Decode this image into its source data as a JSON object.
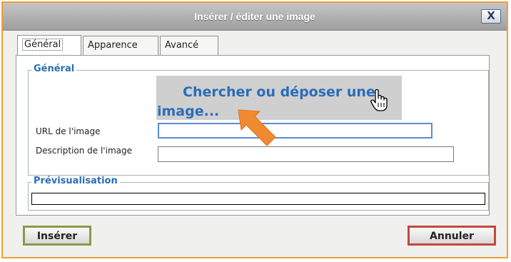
{
  "dialog": {
    "title": "Insérer / éditer une image",
    "close_label": "X"
  },
  "tabs": [
    {
      "label": "Général",
      "active": true
    },
    {
      "label": "Apparence",
      "active": false
    },
    {
      "label": "Avancé",
      "active": false
    }
  ],
  "general": {
    "legend": "Général",
    "drop_zone_text": "Chercher ou déposer une image...",
    "url_label": "URL de l'image",
    "url_value": "",
    "description_label": "Description de l'image",
    "description_value": ""
  },
  "preview": {
    "legend": "Prévisualisation"
  },
  "buttons": {
    "insert": "Insérer",
    "cancel": "Annuler"
  },
  "colors": {
    "accent_blue": "#2a6db8",
    "dialog_border": "#f0a030",
    "arrow": "#f08a30",
    "insert_border": "#8a9a4a",
    "cancel_border": "#c04a3a"
  },
  "icons": [
    "close-icon",
    "hand-pointer-cursor-icon",
    "annotation-arrow-icon"
  ]
}
